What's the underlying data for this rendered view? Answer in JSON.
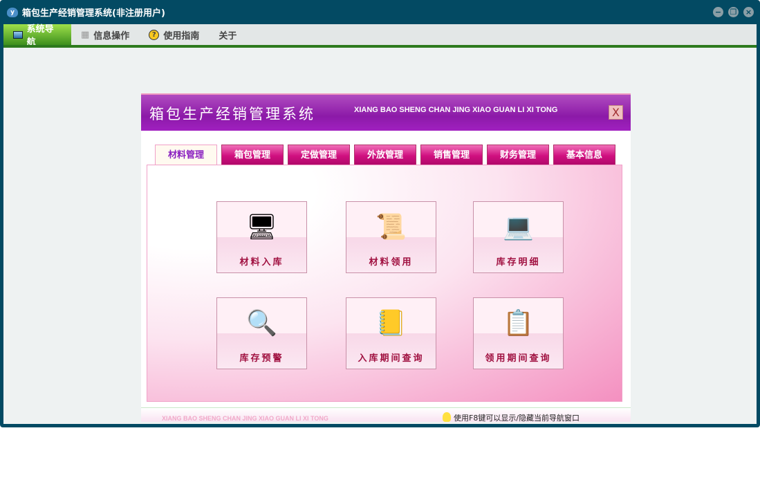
{
  "window": {
    "title": "箱包生产经销管理系统(非注册用户)",
    "app_icon": "y"
  },
  "menu": [
    {
      "label": "系统导航",
      "icon": "monitor-icon"
    },
    {
      "label": "信息操作",
      "icon": "grid-icon"
    },
    {
      "label": "使用指南",
      "icon": "help-icon"
    },
    {
      "label": "关于"
    }
  ],
  "panel": {
    "title": "箱包生产经销管理系统",
    "subtitle": "XIANG BAO SHENG CHAN JING XIAO GUAN LI XI TONG",
    "close": "X",
    "tabs": [
      "材料管理",
      "箱包管理",
      "定做管理",
      "外放管理",
      "销售管理",
      "财务管理",
      "基本信息"
    ],
    "buttons": [
      {
        "label": "材料入库",
        "icon": "🖥"
      },
      {
        "label": "材料领用",
        "icon": "📜"
      },
      {
        "label": "库存明细",
        "icon": "💻"
      },
      {
        "label": "库存预警",
        "icon": "🔍"
      },
      {
        "label": "入库期间查询",
        "icon": "📒"
      },
      {
        "label": "领用期间查询",
        "icon": "📋"
      }
    ],
    "footer_sub": "XIANG BAO SHENG CHAN JING XIAO GUAN LI XI TONG",
    "tip": "使用F8键可以显示/隐藏当前导航窗口"
  },
  "colors": {
    "frame": "#034a63",
    "accent": "#d01080",
    "header": "#8c1aa8"
  }
}
